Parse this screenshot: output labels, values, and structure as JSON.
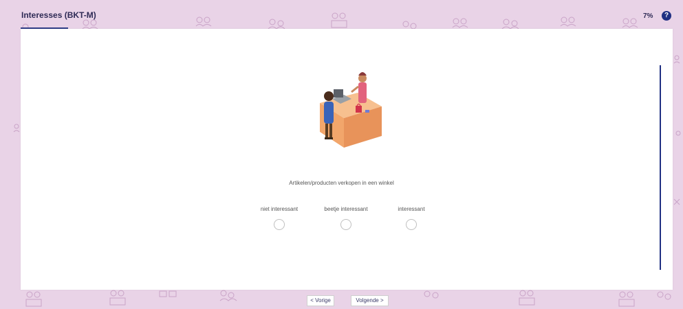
{
  "header": {
    "title": "Interesses (BKT-M)",
    "progress_text": "7%",
    "help_label": "?"
  },
  "question": {
    "text": "Artikelen/producten verkopen in een winkel",
    "options": [
      {
        "label": "niet interessant",
        "selected": false
      },
      {
        "label": "beetje interessant",
        "selected": false
      },
      {
        "label": "interessant",
        "selected": false
      }
    ]
  },
  "navigation": {
    "prev_label": "< Vorige",
    "next_label": "Volgende >"
  },
  "colors": {
    "background": "#e9d3e7",
    "accent": "#1f2f82",
    "doodle": "#c9a3c7"
  }
}
